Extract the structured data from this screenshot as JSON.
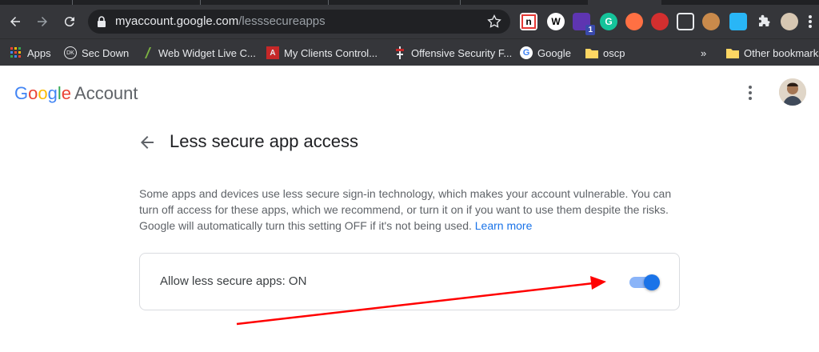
{
  "browser": {
    "url_host": "myaccount.google.com",
    "url_path": "/lesssecureapps",
    "bookmarks": [
      {
        "label": "Apps"
      },
      {
        "label": "Sec Down"
      },
      {
        "label": "Web Widget Live C..."
      },
      {
        "label": "My Clients Control..."
      },
      {
        "label": "Offensive Security F..."
      },
      {
        "label": "Google"
      },
      {
        "label": "oscp"
      }
    ],
    "overflow_label": "»",
    "other_bookmarks": "Other bookmarks",
    "ext_badge": "1",
    "colors": {
      "frame": "#202124",
      "toolbar": "#35363a",
      "omnibox": "#202124"
    }
  },
  "page": {
    "logo": {
      "g1": "G",
      "o1": "o",
      "o2": "o",
      "g2": "g",
      "l": "l",
      "e": "e",
      "suffix": "Account"
    },
    "title": "Less secure app access",
    "description": "Some apps and devices use less secure sign-in technology, which makes your account vulnerable. You can turn off access for these apps, which we recommend, or turn it on if you want to use them despite the risks. Google will automatically turn this setting OFF if it's not being used.",
    "learn_more": "Learn more",
    "setting_label": "Allow less secure apps: ON",
    "toggle_on": true,
    "colors": {
      "accent": "#1a73e8",
      "track": "#8ab4f8",
      "annotation_arrow": "#ff0000"
    }
  }
}
